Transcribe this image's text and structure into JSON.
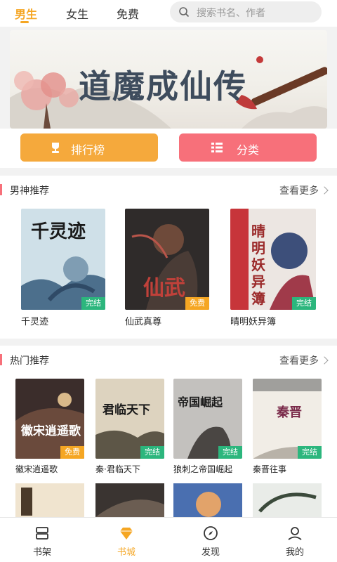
{
  "top_tabs": [
    {
      "label": "男生",
      "active": true
    },
    {
      "label": "女生",
      "active": false
    },
    {
      "label": "免费",
      "active": false
    }
  ],
  "search": {
    "placeholder": "搜索书名、作者"
  },
  "banner": {
    "title": "道魔成仙传",
    "slides": 2
  },
  "buttons": {
    "rank": "排行榜",
    "category": "分类"
  },
  "sections": [
    {
      "title": "男神推荐",
      "more": "查看更多",
      "books": [
        {
          "name": "千灵迹",
          "cover_title": "千灵迹",
          "badge": "完结",
          "badge_type": "done",
          "color": "#c9dde6"
        },
        {
          "name": "仙武真尊",
          "cover_title": "仙武",
          "badge": "免费",
          "badge_type": "free",
          "color": "#3a3534"
        },
        {
          "name": "晴明妖异簿",
          "cover_title": "晴明妖异簿",
          "badge": "完结",
          "badge_type": "done",
          "color": "#e9e3df"
        }
      ]
    },
    {
      "title": "热门推荐",
      "more": "查看更多",
      "books": [
        {
          "name": "徽宋逍遥歌",
          "cover_title": "徽宋逍遥歌",
          "badge": "免费",
          "badge_type": "free",
          "color": "#3a2c2a"
        },
        {
          "name": "秦·君临天下",
          "cover_title": "君临天下",
          "badge": "完结",
          "badge_type": "done",
          "color": "#d7cdb8"
        },
        {
          "name": "狼刺之帝国崛起",
          "cover_title": "帝国崛起",
          "badge": "完结",
          "badge_type": "done",
          "color": "#bdbbb8"
        },
        {
          "name": "秦晋往事",
          "cover_title": "秦晋",
          "badge": "完结",
          "badge_type": "done",
          "color": "#efeae3"
        }
      ]
    }
  ],
  "bottom_nav": [
    {
      "label": "书架",
      "icon": "bookshelf-icon",
      "active": false
    },
    {
      "label": "书城",
      "icon": "diamond-icon",
      "active": true
    },
    {
      "label": "发现",
      "icon": "compass-icon",
      "active": false
    },
    {
      "label": "我的",
      "icon": "user-icon",
      "active": false
    }
  ],
  "colors": {
    "accent": "#f5a623",
    "pink": "#f7707a",
    "green": "#2cb67d"
  }
}
